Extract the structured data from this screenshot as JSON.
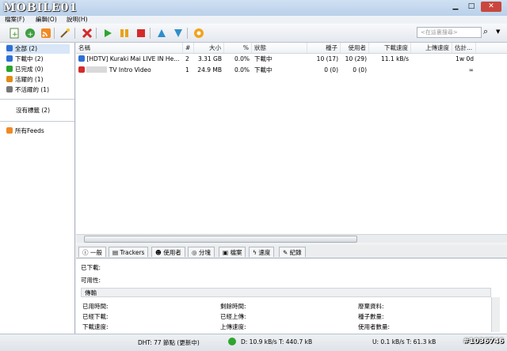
{
  "app": {
    "logo_text": "MOBILE01"
  },
  "menu": [
    "檔案(F)",
    "編輯(O)",
    "說明(H)"
  ],
  "toolbar": {
    "buttons": [
      "add-torrent-icon",
      "add-url-icon",
      "rss-icon",
      "create-torrent-icon",
      "remove-icon",
      "start-icon",
      "pause-icon",
      "stop-icon",
      "move-up-icon",
      "move-down-icon",
      "preferences-icon"
    ],
    "search_placeholder": "<在這裏搜尋>"
  },
  "sidebar": {
    "items": [
      {
        "label": "全部 (2)",
        "color": "#2e6fd6"
      },
      {
        "label": "下載中 (2)",
        "color": "#2e6fd6"
      },
      {
        "label": "已完成 (0)",
        "color": "#2aa52a"
      },
      {
        "label": "活躍的 (1)",
        "color": "#e08b16"
      },
      {
        "label": "不活躍的 (1)",
        "color": "#777777"
      }
    ],
    "no_label": "沒有標籤 (2)",
    "feeds": "所有Feeds"
  },
  "list": {
    "columns": [
      "名稱",
      "#",
      "大小",
      "%",
      "狀態",
      "種子",
      "使用者",
      "下載速度",
      "上傳速度",
      "估計..."
    ],
    "rows": [
      {
        "name": "[HDTV] Kuraki Mai LIVE IN He...",
        "num": "2",
        "size": "3.31 GB",
        "pct": "0.0%",
        "status": "下載中",
        "seeds": "10 (17)",
        "peers": "10 (29)",
        "down": "11.1 kB/s",
        "up": "",
        "eta": "1w 0d"
      },
      {
        "name": "TV Intro Video",
        "num": "1",
        "size": "24.9 MB",
        "pct": "0.0%",
        "status": "下載中",
        "seeds": "0 (0)",
        "peers": "0 (0)",
        "down": "",
        "up": "",
        "eta": "∞"
      }
    ]
  },
  "tabs": [
    "一般",
    "Trackers",
    "使用者",
    "分塊",
    "檔案",
    "速度",
    "紀錄"
  ],
  "general": {
    "downloaded_label": "已下載:",
    "availability_label": "可用性:",
    "transfer_header": "傳輸",
    "col1": [
      "已用時間:",
      "已經下載:",
      "下載速度:"
    ],
    "col2": [
      "剩餘時間:",
      "已經上傳:",
      "上傳速度:"
    ],
    "col3": [
      "廢棄資料:",
      "種子數量:",
      "使用者數量:"
    ]
  },
  "status": {
    "dht": "DHT: 77 節點 (更新中)",
    "down": "D: 10.9 kB/s T: 440.7 kB",
    "up": "U: 0.1 kB/s T: 61.3 kB"
  },
  "watermark": "#1036746"
}
